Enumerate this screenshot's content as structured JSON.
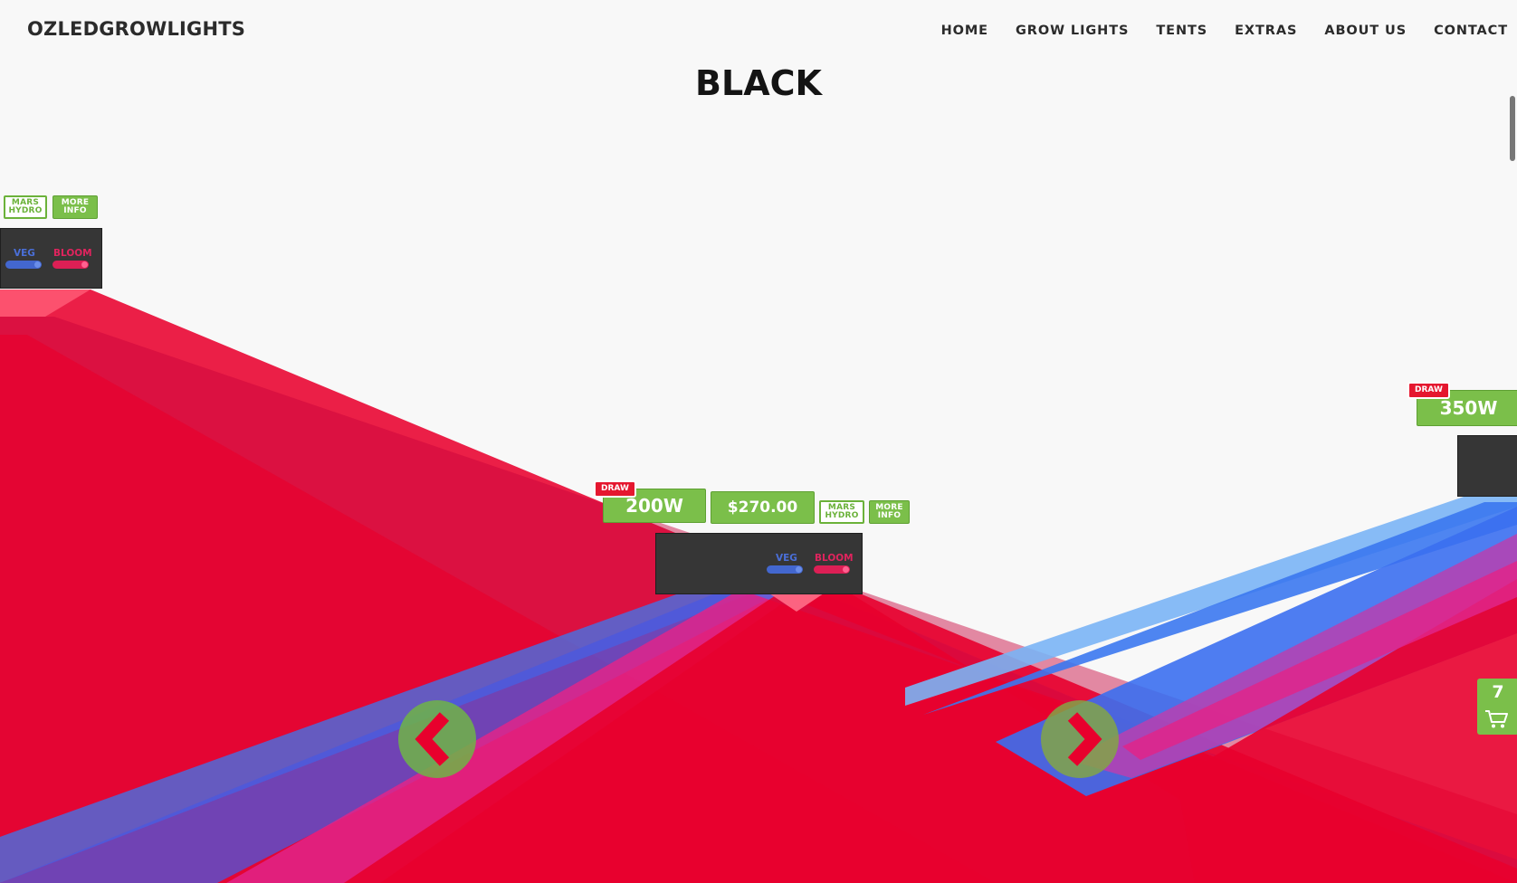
{
  "header": {
    "brand": "OZLEDGROWLIGHTS",
    "nav": [
      "HOME",
      "GROW LIGHTS",
      "TENTS",
      "EXTRAS",
      "ABOUT US",
      "CONTACT"
    ]
  },
  "page": {
    "title": "BLACK"
  },
  "products": {
    "left": {
      "brand_label": "MARS\nHYDRO",
      "more_info": "MORE\nINFO",
      "veg": "VEG",
      "bloom": "BLOOM"
    },
    "center": {
      "badge": "DRAW",
      "wattage": "200W",
      "price": "$270.00",
      "brand_label": "MARS\nHYDRO",
      "more_info": "MORE\nINFO",
      "veg": "VEG",
      "bloom": "BLOOM"
    },
    "right": {
      "badge": "DRAW",
      "wattage": "350W"
    }
  },
  "cart": {
    "count": "7"
  },
  "icons": {
    "prev": "chevron-left-icon",
    "next": "chevron-right-icon",
    "cart": "shopping-cart-icon"
  },
  "colors": {
    "accent_green": "#7bbf4a",
    "badge_red": "#e5172f",
    "beam_red": "#e8002d",
    "beam_blue": "#4a6fe8",
    "beam_pink": "#e0245e",
    "panel": "#363636"
  }
}
